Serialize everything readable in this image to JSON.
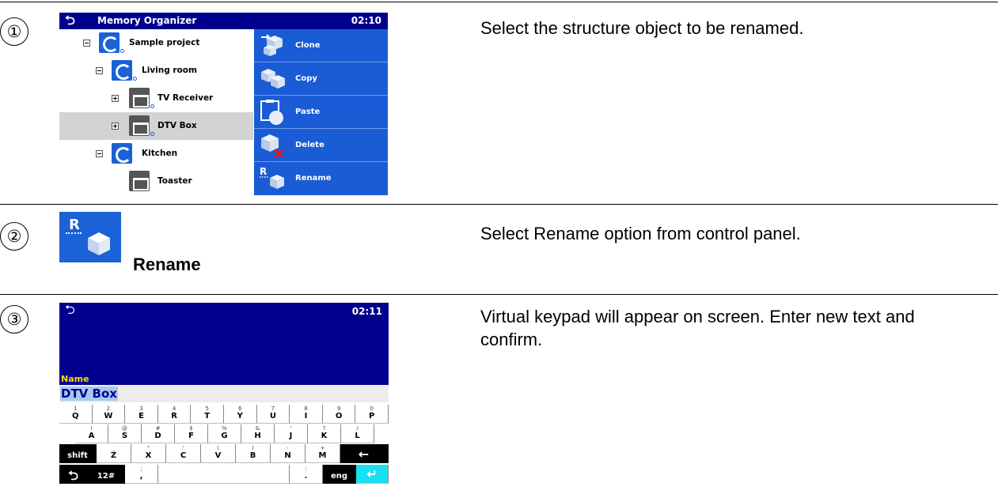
{
  "steps": [
    {
      "number": "①",
      "description": "Select the structure object to be renamed.",
      "screen": {
        "back_glyph": "⮌",
        "title": "Memory Organizer",
        "time": "02:10",
        "tree": [
          {
            "label": "Sample project",
            "icon": "project-icon",
            "expander": "minus",
            "selected": false
          },
          {
            "label": "Living room",
            "icon": "location-icon",
            "expander": "minus",
            "selected": false
          },
          {
            "label": "TV Receiver",
            "icon": "appliance-icon",
            "expander": "plus",
            "selected": false
          },
          {
            "label": "DTV Box",
            "icon": "appliance-icon",
            "expander": "plus",
            "selected": true
          },
          {
            "label": "Kitchen",
            "icon": "location-icon",
            "expander": "minus",
            "selected": false
          },
          {
            "label": "Toaster",
            "icon": "appliance-icon",
            "expander": "none",
            "selected": false
          }
        ],
        "controls": [
          {
            "label": "Clone",
            "icon": "clone-icon"
          },
          {
            "label": "Copy",
            "icon": "copy-icon"
          },
          {
            "label": "Paste",
            "icon": "paste-icon"
          },
          {
            "label": "Delete",
            "icon": "delete-icon"
          },
          {
            "label": "Rename",
            "icon": "rename-icon"
          }
        ]
      }
    },
    {
      "number": "②",
      "description": "Select Rename option from control panel.",
      "icon_letter": "R",
      "icon_label": "Rename"
    },
    {
      "number": "③",
      "description": "Virtual keypad will appear on screen. Enter new text and confirm.",
      "screen": {
        "time": "02:11",
        "field_label": "Name",
        "field_value": "DTV Box",
        "rows": [
          [
            [
              "1",
              "Q"
            ],
            [
              "2",
              "W"
            ],
            [
              "3",
              "E"
            ],
            [
              "4",
              "R"
            ],
            [
              "5",
              "T"
            ],
            [
              "6",
              "Y"
            ],
            [
              "7",
              "U"
            ],
            [
              "8",
              "I"
            ],
            [
              "9",
              "O"
            ],
            [
              "0",
              "P"
            ]
          ],
          [
            [
              "!",
              "A"
            ],
            [
              "@",
              "S"
            ],
            [
              "#",
              "D"
            ],
            [
              "$",
              "F"
            ],
            [
              "%",
              "G"
            ],
            [
              "&",
              "H"
            ],
            [
              "'",
              "J"
            ],
            [
              "?",
              "K"
            ],
            [
              "/",
              "L"
            ]
          ],
          [
            [
              "_",
              "Z"
            ],
            [
              "\"",
              "X"
            ],
            [
              "'",
              "C"
            ],
            [
              "(",
              "V"
            ],
            [
              ")",
              "B"
            ],
            [
              "-",
              "N"
            ],
            [
              "+",
              "M"
            ]
          ]
        ],
        "shift_label": "shift",
        "backspace_glyph": "←",
        "numeric_label": "12#",
        "comma_sub": ";",
        "comma_main": ",",
        "dot_sub": ":",
        "dot_main": ".",
        "lang_label": "eng",
        "enter_glyph": "↵"
      }
    }
  ]
}
